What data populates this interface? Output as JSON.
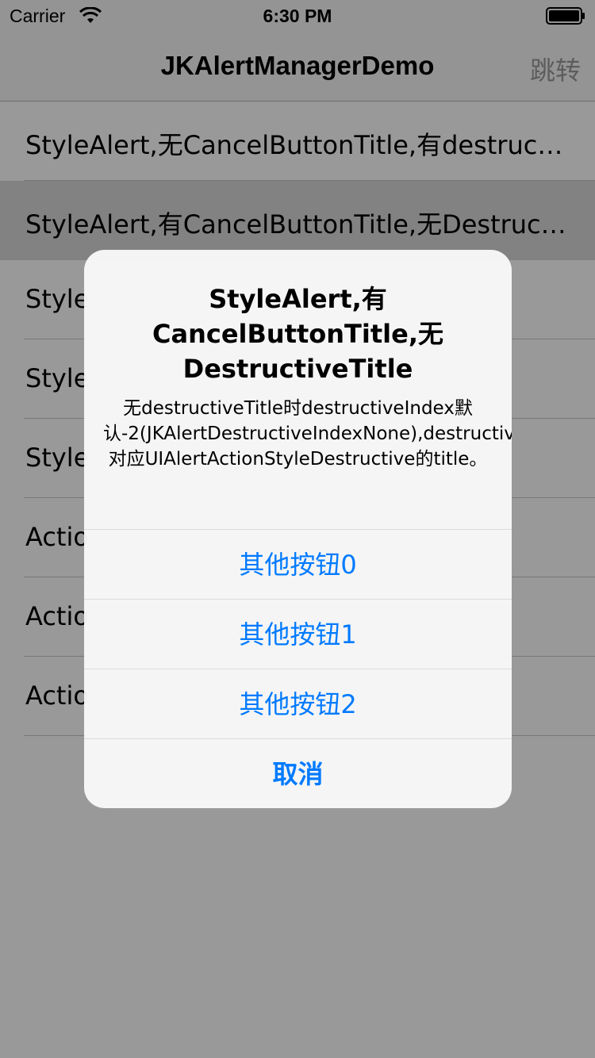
{
  "status_bar": {
    "carrier": "Carrier",
    "time": "6:30 PM",
    "wifi_icon": "wifi-icon",
    "battery_icon": "battery-icon"
  },
  "nav": {
    "title": "JKAlertManagerDemo",
    "right_button": "跳转"
  },
  "table": {
    "rows": [
      {
        "label": "StyleAlert,无CancelButtonTitle,有destructiveTitle"
      },
      {
        "label": "StyleAlert,有CancelButtonTitle,无DestructiveTitle"
      },
      {
        "label": "Style"
      },
      {
        "label": "Style"
      },
      {
        "label": "Style"
      },
      {
        "label": "Actio"
      },
      {
        "label": "Actio"
      },
      {
        "label": "Actio"
      }
    ]
  },
  "alert": {
    "title": "StyleAlert,有CancelButtonTitle,无DestructiveTitle",
    "message": "无destructiveTitle时destructiveIndex默认-2(JKAlertDestructiveIndexNone),destructiveTitle对应UIAlertActionStyleDestructive的title。",
    "buttons": [
      "其他按钮0",
      "其他按钮1",
      "其他按钮2"
    ],
    "cancel": "取消"
  },
  "colors": {
    "accent": "#007aff",
    "overlay": "rgba(0,0,0,0.4)"
  }
}
